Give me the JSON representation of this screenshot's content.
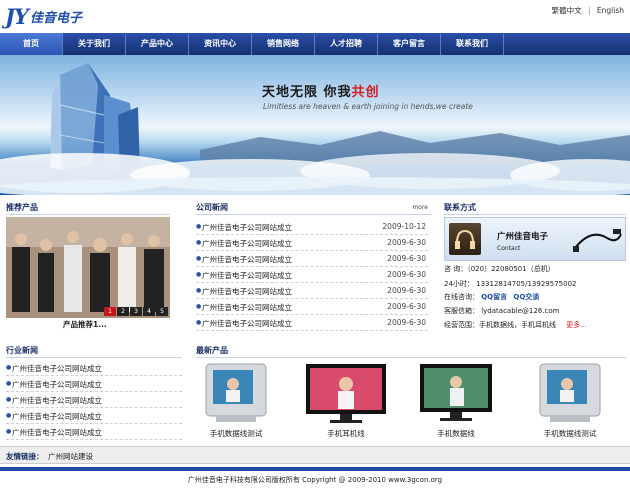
{
  "header": {
    "logo_mark": "JY",
    "logo_text": "佳音电子",
    "lang_zh": "繁體中文",
    "lang_sep": "|",
    "lang_en": "English"
  },
  "nav": {
    "items": [
      "首页",
      "关于我们",
      "产品中心",
      "资讯中心",
      "销售网络",
      "人才招聘",
      "客户留言",
      "联系我们"
    ]
  },
  "banner": {
    "title_part1": "天地无限  你我",
    "title_part2": "共创",
    "subtitle": "Limitless are heaven & earth joining in hends,we create"
  },
  "recommended": {
    "title": "推荐产品",
    "caption": "产品推荐1...",
    "pages": [
      "1",
      "2",
      "3",
      "4",
      "5"
    ],
    "active_page": "1"
  },
  "company_news": {
    "title": "公司新闻",
    "more": "more",
    "items": [
      {
        "title": "广州佳音电子公司网站成立",
        "date": "2009-10-12"
      },
      {
        "title": "广州佳音电子公司网站成立",
        "date": "2009-6-30"
      },
      {
        "title": "广州佳音电子公司网站成立",
        "date": "2009-6-30"
      },
      {
        "title": "广州佳音电子公司网站成立",
        "date": "2009-6-30"
      },
      {
        "title": "广州佳音电子公司网站成立",
        "date": "2009-6-30"
      },
      {
        "title": "广州佳音电子公司网站成立",
        "date": "2009-6-30"
      },
      {
        "title": "广州佳音电子公司网站成立",
        "date": "2009-6-30"
      }
    ]
  },
  "contact": {
    "title": "联系方式",
    "company": "广州佳音电子",
    "company_en": "Contact",
    "phone": "咨  询：（020）22080501（总机）",
    "hotline": "24小时：  13312814705/13929575002",
    "online_label": "在线咨询：",
    "qq1": "QQ留言",
    "qq2": "QQ交谈",
    "email": "客服信箱：  lydatacable@126.com",
    "scope": "经营范围：手机数据线，手机耳机线",
    "scope_more": "更多..."
  },
  "industry_news": {
    "title": "行业新闻",
    "items": [
      "广州佳音电子公司网站成立",
      "广州佳音电子公司网站成立",
      "广州佳音电子公司网站成立",
      "广州佳音电子公司网站成立",
      "广州佳音电子公司网站成立"
    ]
  },
  "new_products": {
    "title": "最新产品",
    "items": [
      {
        "name": "手机数据线测试"
      },
      {
        "name": "手机耳机线"
      },
      {
        "name": "手机数据线"
      },
      {
        "name": "手机数据线测试"
      }
    ]
  },
  "links": {
    "label": "友情链接：",
    "items": [
      "广州网站建设"
    ]
  },
  "footer": {
    "text": "广州佳音电子科技有限公司版权所有 Copyright @ 2009-2010    www.3gcon.org"
  },
  "colors": {
    "nav_bg": "#1f3f8f",
    "accent": "#1f4fa8",
    "highlight_red": "#d21e1e"
  }
}
